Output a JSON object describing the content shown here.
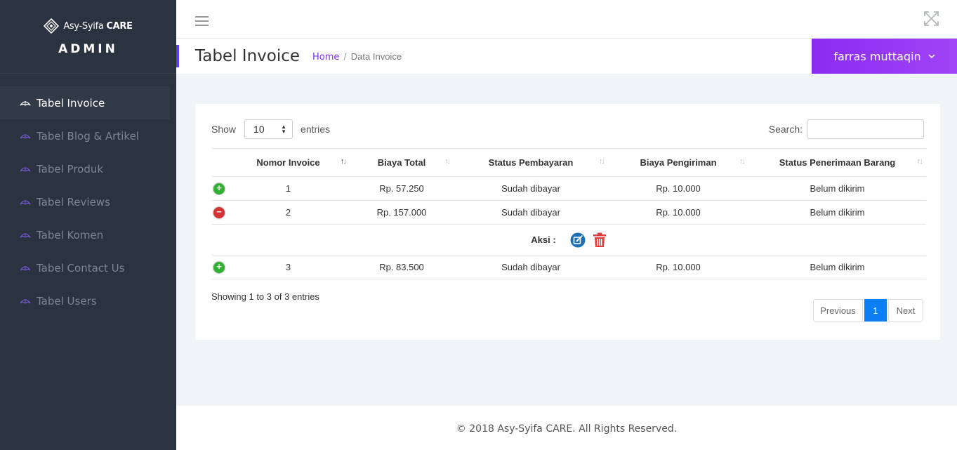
{
  "brand": {
    "logo_text_regular": "Asy-Syifa",
    "logo_text_bold": "CARE",
    "role": "ADMIN"
  },
  "sidebar": {
    "items": [
      {
        "label": "Tabel Invoice",
        "icon": "umbrella-icon",
        "active": true
      },
      {
        "label": "Tabel Blog & Artikel",
        "icon": "umbrella-icon"
      },
      {
        "label": "Tabel Produk",
        "icon": "umbrella-icon"
      },
      {
        "label": "Tabel Reviews",
        "icon": "umbrella-icon"
      },
      {
        "label": "Tabel Komen",
        "icon": "umbrella-icon"
      },
      {
        "label": "Tabel Contact Us",
        "icon": "umbrella-icon"
      },
      {
        "label": "Tabel Users",
        "icon": "umbrella-icon"
      }
    ]
  },
  "header": {
    "menu_icon": "hamburger-icon",
    "fullscreen_icon": "expand-icon"
  },
  "titlebar": {
    "title": "Tabel Invoice",
    "breadcrumb": {
      "home": "Home",
      "separator": "/",
      "current": "Data Invoice"
    },
    "user": "farras muttaqin",
    "accent_color": "#5b3df5",
    "user_color": "#8a2bf2"
  },
  "table_controls": {
    "show_label": "Show",
    "entries_value": "10",
    "entries_label": "entries",
    "search_label": "Search:",
    "search_value": ""
  },
  "table": {
    "columns": [
      "Nomor Invoice",
      "Biaya Total",
      "Status Pembayaran",
      "Biaya Pengiriman",
      "Status Penerimaan Barang"
    ],
    "rows": [
      {
        "nomor": "1",
        "total": "Rp. 57.250",
        "bayar": "Sudah dibayar",
        "kirim": "Rp. 10.000",
        "terima": "Belum dikirim",
        "expanded": false
      },
      {
        "nomor": "2",
        "total": "Rp. 157.000",
        "bayar": "Sudah dibayar",
        "kirim": "Rp. 10.000",
        "terima": "Belum dikirim",
        "expanded": true
      },
      {
        "nomor": "3",
        "total": "Rp. 83.500",
        "bayar": "Sudah dibayar",
        "kirim": "Rp. 10.000",
        "terima": "Belum dikirim",
        "expanded": false
      }
    ],
    "child_label": "Aksi :",
    "expand_symbol": "+",
    "collapse_symbol": "−"
  },
  "info": "Showing 1 to 3 of 3 entries",
  "pagination": {
    "previous": "Previous",
    "page": "1",
    "next": "Next",
    "active_color": "#0d7ff5"
  },
  "footer": "© 2018 Asy-Syifa CARE. All Rights Reserved."
}
